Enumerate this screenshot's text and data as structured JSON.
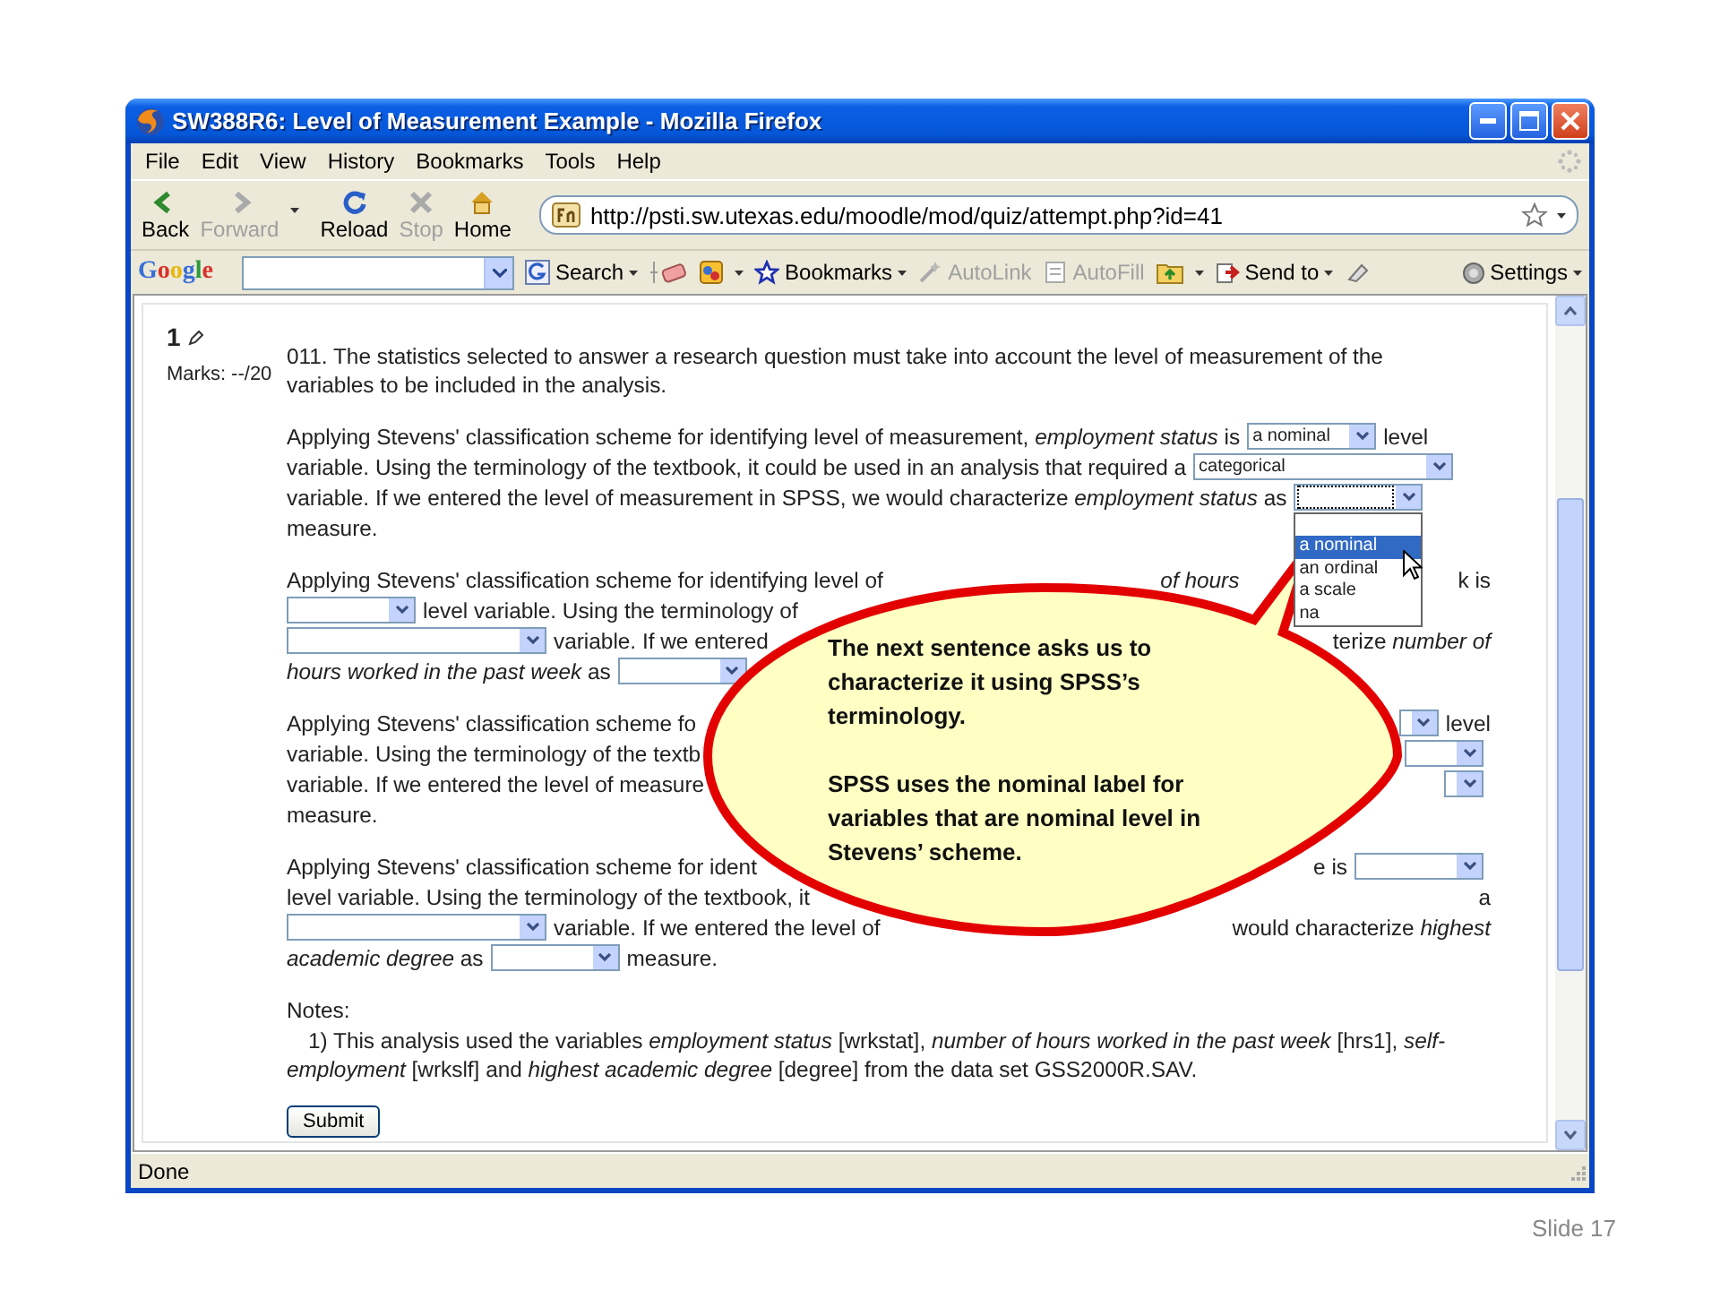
{
  "window": {
    "title": "SW388R6: Level of Measurement Example - Mozilla Firefox"
  },
  "menu": [
    "File",
    "Edit",
    "View",
    "History",
    "Bookmarks",
    "Tools",
    "Help"
  ],
  "nav_buttons": [
    {
      "kind": "back",
      "label": "Back",
      "disabled": false
    },
    {
      "kind": "forward",
      "label": "Forward",
      "disabled": true
    },
    {
      "kind": "reload",
      "label": "Reload",
      "disabled": false
    },
    {
      "kind": "stop",
      "label": "Stop",
      "disabled": true
    },
    {
      "kind": "home",
      "label": "Home",
      "disabled": false
    }
  ],
  "address_bar": {
    "url": "http://psti.sw.utexas.edu/moodle/mod/quiz/attempt.php?id=41"
  },
  "google_toolbar": {
    "logo": "Google",
    "items": [
      {
        "kind": "search",
        "label": "Search",
        "disabled": false
      },
      {
        "kind": "bookmarks",
        "label": "Bookmarks",
        "disabled": false
      },
      {
        "kind": "autolink",
        "label": "AutoLink",
        "disabled": true
      },
      {
        "kind": "autofill",
        "label": "AutoFill",
        "disabled": true
      },
      {
        "kind": "sendto",
        "label": "Send to",
        "disabled": false
      }
    ],
    "settings": "Settings"
  },
  "question": {
    "number": "1",
    "marks": "Marks: --/20",
    "intro": "011. The statistics selected to answer a research question must take into account the level of measurement of the variables to be included in the analysis.",
    "paragraphs": [
      {
        "lines": [
          {
            "left": [
              {
                "kind": "text",
                "text": "Applying Stevens' classification scheme for identifying level of measurement, *employment status* is"
              },
              {
                "kind": "select",
                "value": "a nominal",
                "open": false
              },
              {
                "kind": "text",
                "text": "level"
              }
            ]
          },
          {
            "left": [
              {
                "kind": "text",
                "text": "variable. Using the terminology of the textbook, it could be used in an analysis that required a"
              },
              {
                "kind": "wide-select",
                "value": "categorical",
                "open": false
              }
            ]
          },
          {
            "left": [
              {
                "kind": "text",
                "text": "variable. If we entered the level of measurement in SPSS, we would characterize *employment status* as"
              },
              {
                "kind": "select",
                "open": true
              }
            ]
          },
          {
            "left": [
              {
                "kind": "text",
                "text": "measure."
              }
            ]
          }
        ]
      },
      {
        "lines": [
          {
            "left": [
              {
                "kind": "text",
                "text": "Applying Stevens' classification scheme for identifying level of"
              }
            ],
            "right_parts": [
              {
                "segments": [
                  {
                    "kind": "text",
                    "text": "*of hours*"
                  }
                ]
              },
              {
                "segments": [
                  {
                    "kind": "text",
                    "text": "k is"
                  }
                ]
              }
            ]
          },
          {
            "left": [
              {
                "kind": "select",
                "open": false
              },
              {
                "kind": "text",
                "text": "level variable. Using the terminology of"
              }
            ]
          },
          {
            "left": [
              {
                "kind": "wide-select",
                "open": false
              },
              {
                "kind": "text",
                "text": "variable. If we entered"
              }
            ],
            "right_parts": [
              {
                "segments": [
                  {
                    "kind": "text",
                    "text": "terize *number of*"
                  }
                ]
              }
            ]
          },
          {
            "left": [
              {
                "kind": "text",
                "text": "*hours worked in the past week* as"
              },
              {
                "kind": "select",
                "open": false
              }
            ]
          }
        ]
      },
      {
        "lines": [
          {
            "left": [
              {
                "kind": "text",
                "text": "Applying Stevens' classification scheme fo"
              }
            ],
            "right_parts": [
              {
                "segments": [
                  {
                    "kind": "select",
                    "open": false
                  },
                  {
                    "kind": "text",
                    "text": "level"
                  }
                ]
              }
            ]
          },
          {
            "left": [
              {
                "kind": "text",
                "text": "variable. Using the terminology of the textb"
              }
            ],
            "right_parts": [
              {
                "segments": [
                  {
                    "kind": "wide-select",
                    "open": false
                  }
                ]
              }
            ]
          },
          {
            "left": [
              {
                "kind": "text",
                "text": "variable. If we entered the level of measure"
              }
            ],
            "right_parts": [
              {
                "segments": [
                  {
                    "kind": "select",
                    "open": false
                  }
                ]
              }
            ]
          },
          {
            "left": [
              {
                "kind": "text",
                "text": "measure."
              }
            ]
          }
        ]
      },
      {
        "lines": [
          {
            "left": [
              {
                "kind": "text",
                "text": "Applying Stevens' classification scheme for ident"
              }
            ],
            "right_parts": [
              {
                "segments": [
                  {
                    "kind": "text",
                    "text": "e is"
                  },
                  {
                    "kind": "select",
                    "open": false
                  }
                ]
              }
            ]
          },
          {
            "left": [
              {
                "kind": "text",
                "text": "level variable. Using the terminology of the textbook, it"
              }
            ],
            "right_parts": [
              {
                "segments": [
                  {
                    "kind": "text",
                    "text": "a"
                  }
                ]
              }
            ]
          },
          {
            "left": [
              {
                "kind": "wide-select",
                "open": false
              },
              {
                "kind": "text",
                "text": "variable. If we entered the level of"
              }
            ],
            "right_parts": [
              {
                "segments": [
                  {
                    "kind": "text",
                    "text": "would characterize *highest*"
                  }
                ]
              }
            ]
          },
          {
            "left": [
              {
                "kind": "text",
                "text": "*academic degree* as"
              },
              {
                "kind": "select",
                "open": false
              },
              {
                "kind": "text",
                "text": "measure."
              }
            ]
          }
        ]
      }
    ],
    "notes_title": "Notes:",
    "note": "1) This analysis used the variables *employment status* [wrkstat], *number of hours worked in the past week* [hrs1], *self-employment* [wrkslf] and *highest academic degree* [degree] from the data set GSS2000R.SAV.",
    "submit": "Submit"
  },
  "dropdown": {
    "options": [
      {
        "label": "a nominal",
        "selected": true
      },
      {
        "label": "an ordinal",
        "selected": false
      },
      {
        "label": "a scale",
        "selected": false
      },
      {
        "label": "na",
        "selected": false
      }
    ]
  },
  "callout": {
    "paragraphs": [
      "The next sentence asks us to characterize it using SPSS’s terminology.",
      "SPSS uses the nominal label for variables that are nominal level in Stevens’ scheme."
    ]
  },
  "status_bar": "Done",
  "slide": {
    "label": "Slide 17"
  }
}
